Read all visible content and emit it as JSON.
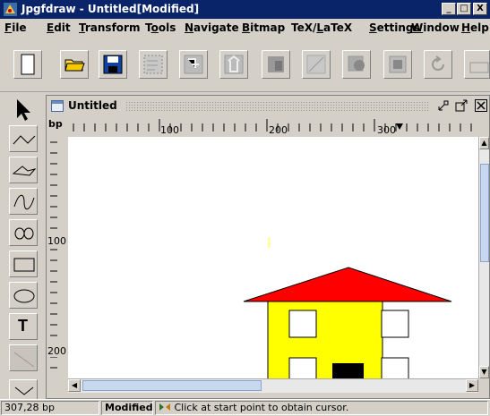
{
  "window": {
    "title": "Jpgfdraw - Untitled[Modified]",
    "controls": {
      "minimize": "_",
      "maximize": "□",
      "close": "X"
    }
  },
  "menubar": {
    "items": [
      {
        "label": "File",
        "u": "F",
        "rest": "ile"
      },
      {
        "label": "Edit",
        "u": "E",
        "rest": "dit"
      },
      {
        "label": "Transform",
        "u": "T",
        "rest": "ransform"
      },
      {
        "label": "Tools",
        "pre": "T",
        "u": "o",
        "rest": "ols"
      },
      {
        "label": "Navigate",
        "u": "N",
        "rest": "avigate"
      },
      {
        "label": "Bitmap",
        "u": "B",
        "rest": "itmap"
      },
      {
        "label": "TeX/LaTeX",
        "pre": "TeX/",
        "u": "L",
        "rest": "aTeX"
      },
      {
        "label": "Settings",
        "u": "S",
        "rest": "ettings"
      },
      {
        "label": "Window",
        "u": "W",
        "rest": "indow"
      },
      {
        "label": "Help",
        "u": "H",
        "rest": "elp"
      }
    ]
  },
  "toolbar": {
    "buttons": [
      "new-icon",
      "open-folder-icon",
      "save-icon",
      "select-region-icon",
      "import-icon",
      "export-icon",
      "bitmap-icon",
      "path-icon",
      "group-icon",
      "ungroup-icon",
      "rotate-icon",
      "scale-icon"
    ]
  },
  "tools": {
    "items": [
      "select-arrow-icon",
      "open-line-icon",
      "closed-line-icon",
      "curve-icon",
      "closed-curve-icon",
      "rectangle-icon",
      "ellipse-icon",
      "text-icon",
      "math-text-icon",
      "more-icon"
    ],
    "text_tool_label": "T"
  },
  "document": {
    "title": "Untitled",
    "frame_controls": {
      "iconify": "▫",
      "maximize": "□",
      "close": "X"
    },
    "unit_label": "bp",
    "hruler_labels": [
      "100",
      "200",
      "300"
    ],
    "vruler_labels": [
      "100",
      "200"
    ]
  },
  "drawing": {
    "roof_color": "#ff0000",
    "wall_color": "#ffff00",
    "door_color": "#000000",
    "window_color": "#ffffff"
  },
  "statusbar": {
    "position": "307,28 bp",
    "modified": "Modified",
    "message": "Click at start point to obtain cursor."
  }
}
